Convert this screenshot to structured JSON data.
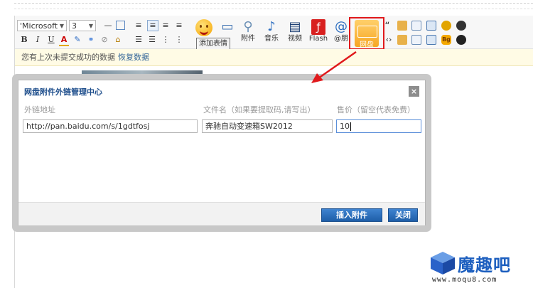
{
  "toolbar": {
    "font_select": "'Microsoft",
    "size_select": "3",
    "items": {
      "emotion": "添加表情",
      "attach": "附件",
      "music": "音乐",
      "video": "视频",
      "flash": "Flash",
      "at": "@朋",
      "wangpan": "网盘"
    }
  },
  "tooltip": "添加表情",
  "notice": {
    "text": "您有上次未提交成功的数据",
    "restore": "恢复数据"
  },
  "dialog": {
    "title": "网盘附件外链管理中心",
    "columns": {
      "url": "外链地址",
      "filename": "文件名（如果要提取码,请写出）",
      "price": "售价（留空代表免费）"
    },
    "values": {
      "url": "http://pan.baidu.com/s/1gdtfosj",
      "filename": "奔驰自动变速箱SW2012",
      "price": "10"
    },
    "buttons": {
      "insert": "插入附件",
      "close": "关闭"
    }
  },
  "watermark": {
    "brand": "魔趣吧",
    "url": "www.moqu8.com"
  },
  "colors": {
    "highlight": "#e0191c",
    "title": "#1e4e8c",
    "button": "#2a6cbb"
  }
}
